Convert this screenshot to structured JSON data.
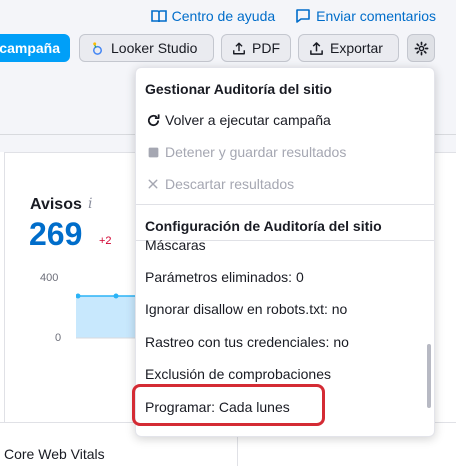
{
  "top_links": {
    "help": "Centro de ayuda",
    "feedback": "Enviar comentarios"
  },
  "toolbar": {
    "campaign_label": "campaña",
    "looker_label": "Looker Studio",
    "pdf_label": "PDF",
    "export_label": "Exportar"
  },
  "widget": {
    "title": "Avisos",
    "info_glyph": "i",
    "value": "269",
    "delta": "+2",
    "axis_top": "400",
    "axis_bottom": "0"
  },
  "bottom": {
    "core_web_vitals": "Core Web Vitals"
  },
  "menu": {
    "section1_title": "Gestionar Auditoría del sitio",
    "rerun": "Volver a ejecutar campaña",
    "stop_save": "Detener y guardar resultados",
    "discard": "Descartar resultados",
    "section2_title": "Configuración de Auditoría del sitio",
    "masks": "Máscaras",
    "removed_params": "Parámetros eliminados: 0",
    "ignore_disallow": "Ignorar disallow en robots.txt: no",
    "crawl_credentials": "Rastreo con tus credenciales: no",
    "check_exclusion": "Exclusión de comprobaciones",
    "schedule": "Programar: Cada lunes"
  },
  "colors": {
    "accent": "#006dca",
    "primary_button": "#009ff8",
    "highlight": "#d42b34",
    "delta_red": "#d1002f"
  },
  "icons": {
    "help": "book-icon",
    "feedback": "comment-icon",
    "looker": "looker-studio-icon",
    "pdf": "upload-icon",
    "export": "upload-icon",
    "settings": "gear-icon",
    "rerun": "refresh-icon",
    "stop": "stop-icon",
    "discard": "close-icon"
  }
}
